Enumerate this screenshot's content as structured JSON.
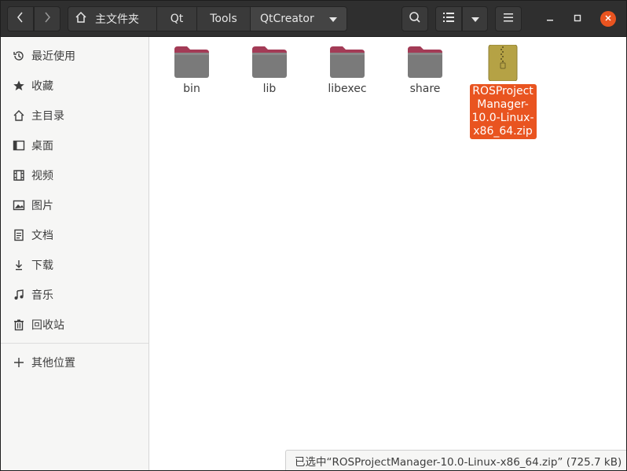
{
  "header": {
    "breadcrumbs": [
      {
        "label": "主文件夹",
        "icon": "home-icon"
      },
      {
        "label": "Qt"
      },
      {
        "label": "Tools"
      },
      {
        "label": "QtCreator"
      }
    ],
    "controls": {
      "back_icon": "chevron-left-icon",
      "forward_icon": "chevron-right-icon",
      "search_icon": "search-icon",
      "view_icon": "list-view-icon",
      "menu_icon": "hamburger-menu-icon"
    }
  },
  "sidebar": {
    "items": [
      {
        "label": "最近使用",
        "icon": "recent-clock-icon"
      },
      {
        "label": "收藏",
        "icon": "star-icon"
      },
      {
        "label": "主目录",
        "icon": "home-icon"
      },
      {
        "label": "桌面",
        "icon": "desktop-icon"
      },
      {
        "label": "视频",
        "icon": "video-icon"
      },
      {
        "label": "图片",
        "icon": "picture-icon"
      },
      {
        "label": "文档",
        "icon": "document-icon"
      },
      {
        "label": "下载",
        "icon": "download-icon"
      },
      {
        "label": "音乐",
        "icon": "music-icon"
      },
      {
        "label": "回收站",
        "icon": "trash-icon"
      }
    ],
    "other_locations": {
      "label": "其他位置",
      "icon": "plus-icon"
    }
  },
  "files": [
    {
      "name": "bin",
      "type": "folder"
    },
    {
      "name": "lib",
      "type": "folder"
    },
    {
      "name": "libexec",
      "type": "folder"
    },
    {
      "name": "share",
      "type": "folder"
    },
    {
      "name": "ROSProject Manager-10.0-Linux-x86_64.zip",
      "type": "zip",
      "selected": true
    }
  ],
  "status": {
    "text": "已选中“ROSProjectManager-10.0-Linux-x86_64.zip” (725.7 kB)"
  },
  "colors": {
    "accent": "#e95420",
    "folder_tab": "#a33b56",
    "folder_body": "#7a7a7a",
    "zip": "#b5a245"
  }
}
